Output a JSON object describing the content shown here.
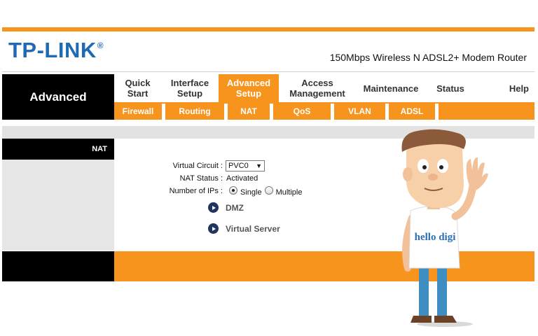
{
  "brand": {
    "logo": "TP-LINK",
    "registered": "®",
    "model": "150Mbps Wireless N ADSL2+ Modem Router"
  },
  "section_title": "Advanced",
  "main_tabs": [
    {
      "label1": "Quick",
      "label2": "Start"
    },
    {
      "label1": "Interface",
      "label2": "Setup"
    },
    {
      "label1": "Advanced",
      "label2": "Setup",
      "active": true
    },
    {
      "label1": "Access",
      "label2": "Management"
    },
    {
      "label1": "Maintenance",
      "label2": ""
    },
    {
      "label1": "Status",
      "label2": ""
    },
    {
      "label1": "Help",
      "label2": ""
    }
  ],
  "sub_tabs": [
    "Firewall",
    "Routing",
    "NAT",
    "QoS",
    "VLAN",
    "ADSL"
  ],
  "sidebar": {
    "heading": "NAT"
  },
  "form": {
    "virtual_circuit_label": "Virtual Circuit :",
    "virtual_circuit_value": "PVC0",
    "nat_status_label": "NAT Status :",
    "nat_status_value": "Activated",
    "num_ips_label": "Number of IPs :",
    "option_single": "Single",
    "option_multiple": "Multiple",
    "selected_option": "Single"
  },
  "links": {
    "dmz": "DMZ",
    "virtual_server": "Virtual Server"
  },
  "mascot": {
    "shirt_text": "hello digi"
  },
  "colors": {
    "accent": "#f7941d",
    "logo_blue": "#1e6ab4",
    "link_icon": "#1f3460"
  }
}
